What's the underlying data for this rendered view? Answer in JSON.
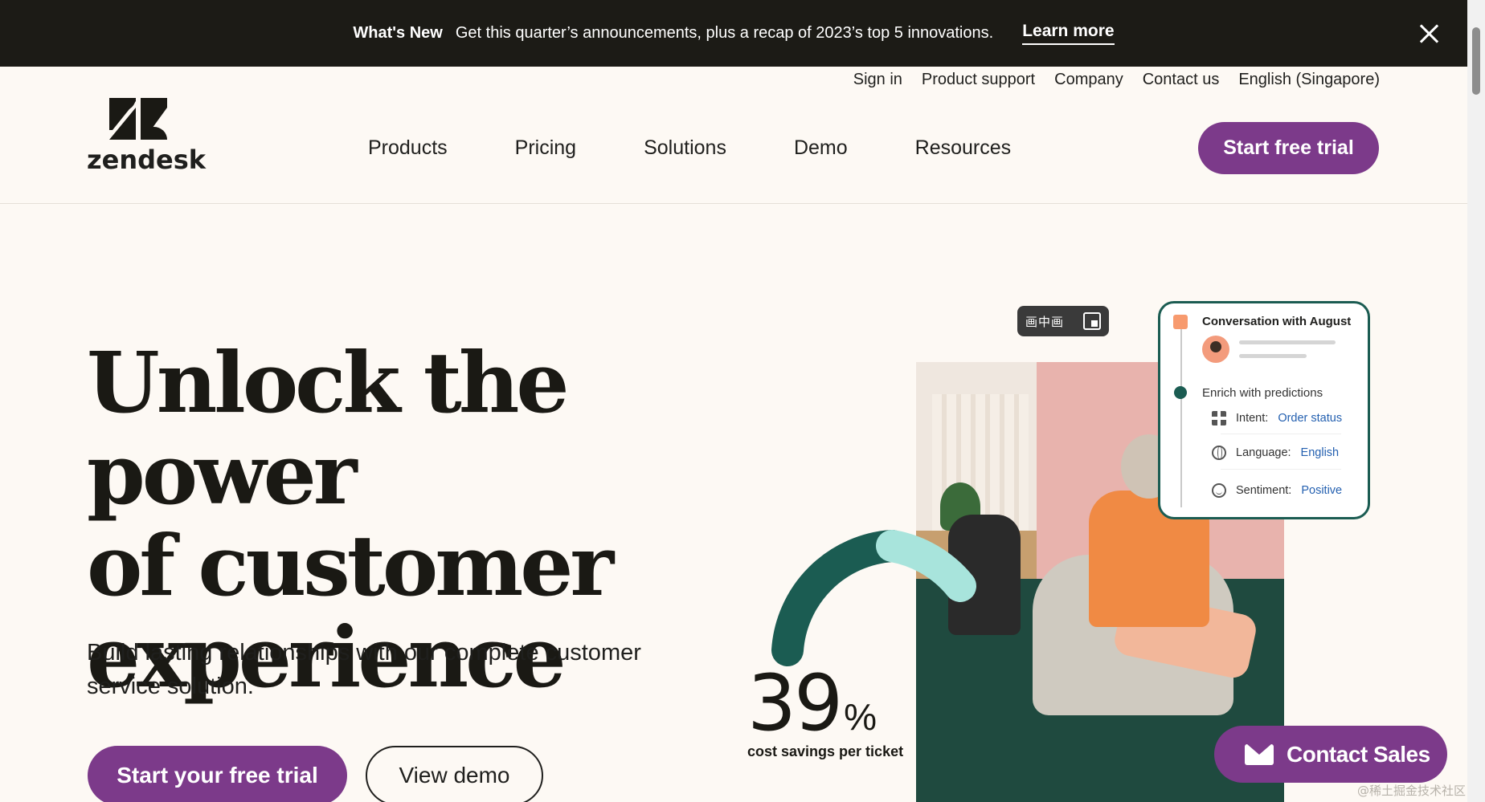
{
  "announcement": {
    "label": "What's New",
    "message": "Get this quarter’s announcements, plus a recap of 2023’s top 5 innovations.",
    "link": "Learn more"
  },
  "utility_nav": [
    "Sign in",
    "Product support",
    "Company",
    "Contact us",
    "English (Singapore)"
  ],
  "logo": {
    "wordmark": "zendesk"
  },
  "main_nav": [
    "Products",
    "Pricing",
    "Solutions",
    "Demo",
    "Resources"
  ],
  "header_cta": "Start free trial",
  "hero": {
    "title_line1": "Unlock the power",
    "title_line2": "of customer",
    "title_line3": "experience",
    "subtitle": "Build lasting relationships with our complete customer service solution.",
    "primary_cta": "Start your free trial",
    "secondary_cta": "View demo"
  },
  "stat": {
    "value": "39",
    "unit": "%",
    "caption": "cost savings per ticket"
  },
  "pip_overlay": {
    "label": "画中画"
  },
  "conversation_card": {
    "title": "Conversation with August",
    "enrich_label": "Enrich with predictions",
    "rows": [
      {
        "label": "Intent:",
        "value": "Order status",
        "icon": "grid-icon"
      },
      {
        "label": "Language:",
        "value": "English",
        "icon": "globe-icon"
      },
      {
        "label": "Sentiment:",
        "value": "Positive",
        "icon": "smile-icon"
      }
    ]
  },
  "contact_sales": "Contact Sales",
  "watermark": "@稀土掘金技术社区",
  "colors": {
    "brand_purple": "#7c3a8a",
    "dark_green": "#1b5c52",
    "mint": "#a8e4dc",
    "bar_bg": "#1c1b16"
  }
}
